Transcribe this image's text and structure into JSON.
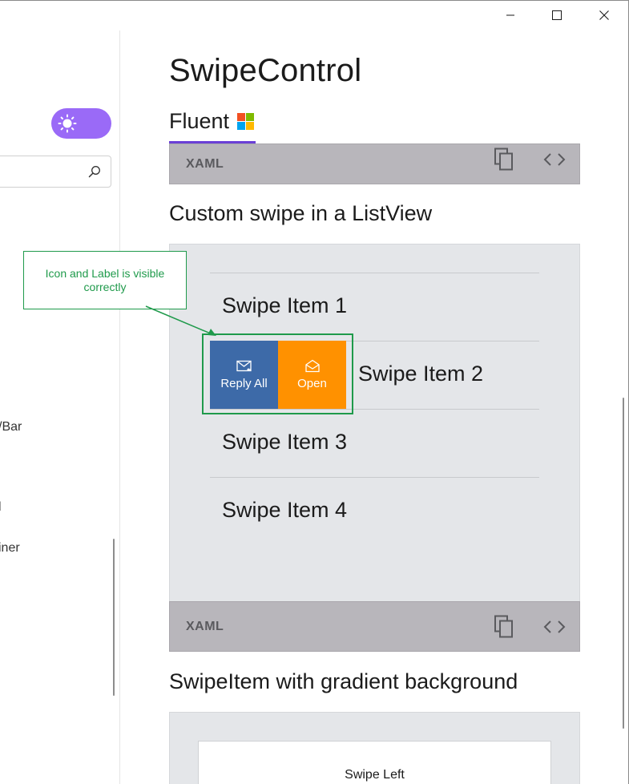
{
  "window": {
    "minimize_icon": "minimize-icon",
    "maximize_icon": "maximize-icon",
    "close_icon": "close-icon"
  },
  "sidebar": {
    "theme_toggle_icon": "sun-icon",
    "search_icon": "search-icon",
    "items": [
      {
        "label": "/Bar"
      },
      {
        "label": "l"
      },
      {
        "label": "iner"
      }
    ]
  },
  "main": {
    "title": "SwipeControl",
    "tab": {
      "label": "Fluent",
      "icon": "windows-logo-icon"
    },
    "xaml_label": "XAML",
    "sections": [
      {
        "title": "Custom swipe in a ListView",
        "items": [
          "Swipe Item 1",
          "Swipe Item 2",
          "Swipe Item 3",
          "Swipe Item 4"
        ],
        "swipe_actions": [
          {
            "label": "Reply All",
            "icon": "mail-reply-all-icon",
            "color": "#3d6aa8"
          },
          {
            "label": "Open",
            "icon": "mail-open-icon",
            "color": "#ff9100"
          }
        ]
      },
      {
        "title": "SwipeItem with gradient background",
        "items": [
          "Swipe Left"
        ]
      }
    ],
    "annotation": "Icon and Label is visible correctly"
  },
  "colors": {
    "accent": "#6a3fd6",
    "toggle": "#9a6af7",
    "annotation": "#1f9a4b",
    "xaml_bar": "#b8b6bb",
    "panel": "#e4e6e9"
  }
}
